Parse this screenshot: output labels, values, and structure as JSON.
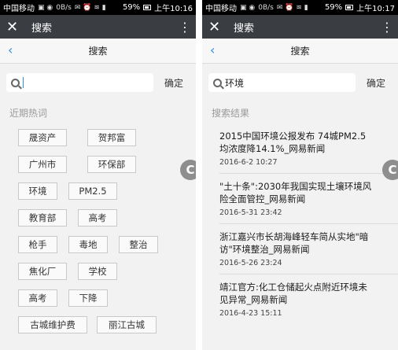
{
  "left": {
    "status": {
      "carrier": "中国移动",
      "speed": "0B/s",
      "battery": "59%",
      "time": "上午10:16"
    },
    "app_bar": {
      "title": "搜索"
    },
    "nav": {
      "title": "搜索"
    },
    "search": {
      "value": "",
      "confirm_label": "确定"
    },
    "hot": {
      "label": "近期热词",
      "rows": [
        [
          "晟资产",
          "贺邦富"
        ],
        [
          "广州市",
          "环保部"
        ],
        [
          "环境",
          "PM2.5"
        ],
        [
          "教育部",
          "高考"
        ],
        [
          "枪手",
          "毒地",
          "整治"
        ],
        [
          "焦化厂",
          "学校"
        ],
        [
          "高考",
          "下降"
        ],
        [
          "古城维护费",
          "丽江古城"
        ]
      ]
    },
    "float_icon": "C"
  },
  "right": {
    "status": {
      "carrier": "中国移动",
      "speed": "0B/s",
      "battery": "59%",
      "time": "上午10:17"
    },
    "app_bar": {
      "title": "搜索"
    },
    "nav": {
      "title": "搜索"
    },
    "search": {
      "value": "环境",
      "confirm_label": "确定"
    },
    "results_label": "搜索结果",
    "results": [
      {
        "title_lines": [
          "2015中国环境公报发布 74城PM2.5",
          "均浓度降14.1%_网易新闻"
        ],
        "date": "2016-6-2 10:27"
      },
      {
        "title_lines": [
          "\"土十条\":2030年我国实现土壤环境风",
          "险全面管控_网易新闻"
        ],
        "date": "2016-5-31 23:42"
      },
      {
        "title_lines": [
          "浙江嘉兴市长胡海峰轻车简从实地\"暗",
          "访\"环境整治_网易新闻"
        ],
        "date": "2016-5-26 23:24"
      },
      {
        "title_lines": [
          "靖江官方:化工仓储起火点附近环境未",
          "见异常_网易新闻"
        ],
        "date": "2016-4-23 15:11"
      }
    ],
    "float_icon": "C"
  }
}
